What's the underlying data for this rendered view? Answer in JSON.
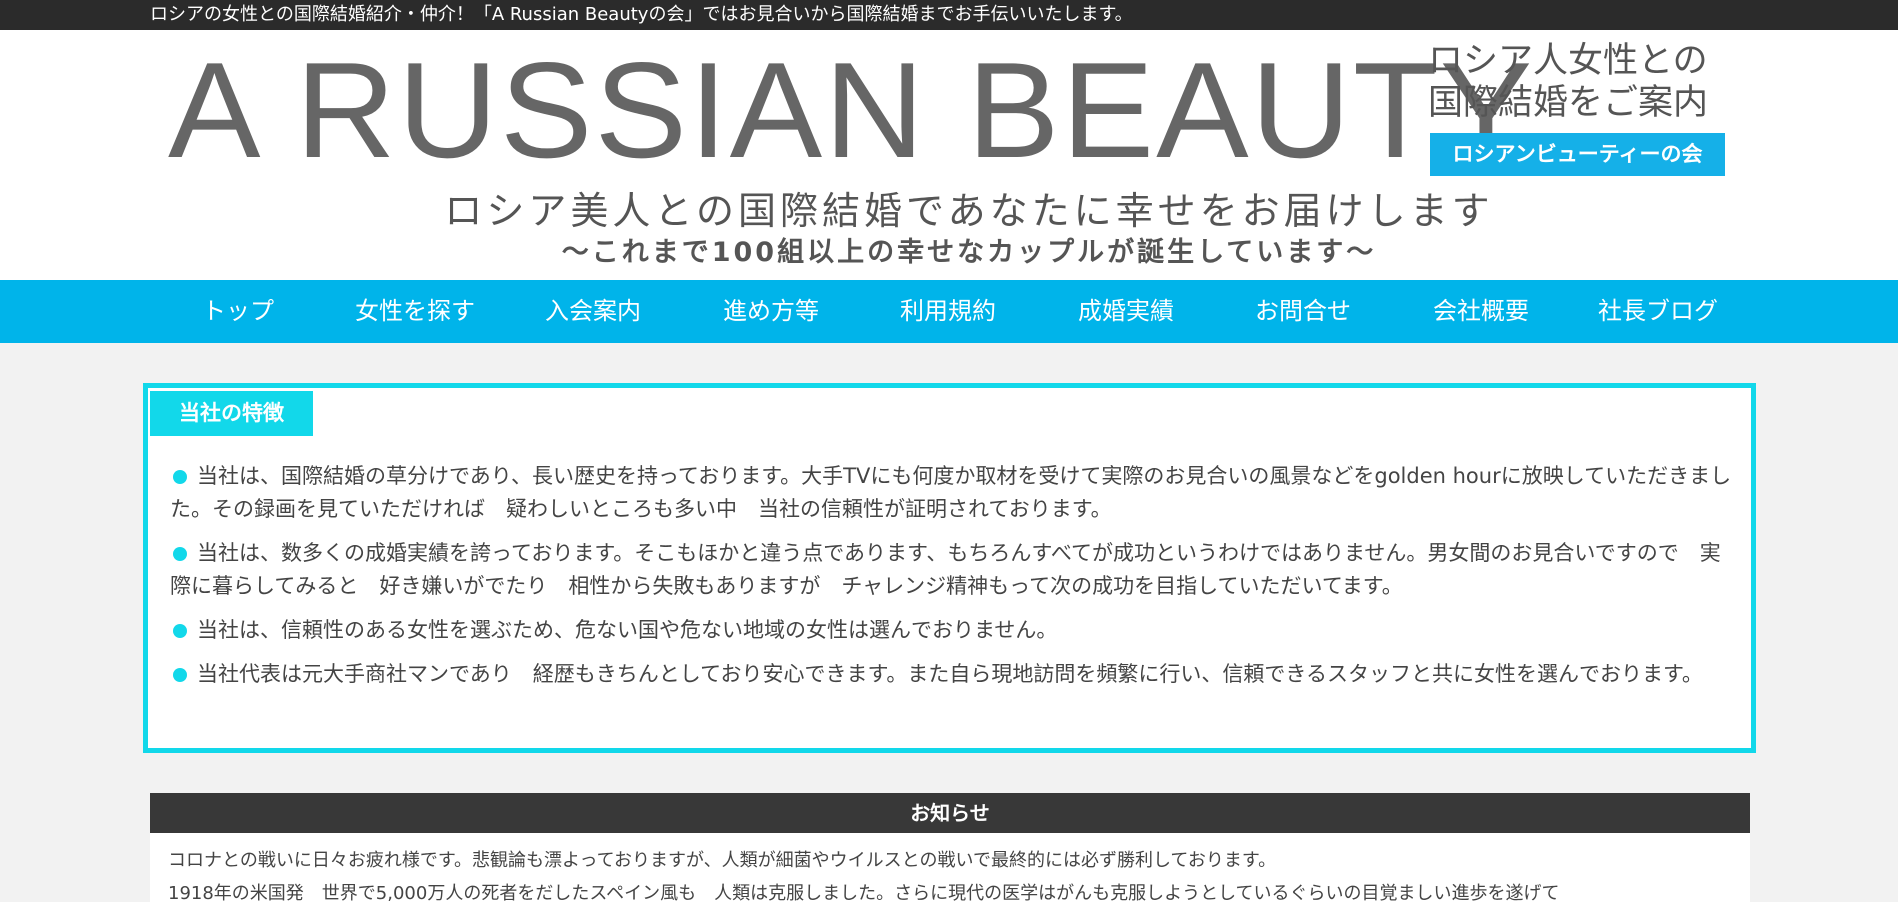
{
  "topbar": {
    "text": "ロシアの女性との国際結婚紹介・仲介！「A Russian Beautyの会」ではお見合いから国際結婚までお手伝いいたします。"
  },
  "header": {
    "logo": "A RUSSIAN BEAUTY",
    "tagline_line1": "ロシア人女性との",
    "tagline_line2": "国際結婚をご案内",
    "badge": "ロシアンビューティーの会",
    "subline1": "ロシア美人との国際結婚であなたに幸せをお届けします",
    "subline2": "～これまで100組以上の幸せなカップルが誕生しています～"
  },
  "nav": {
    "items": [
      {
        "label": "トップ"
      },
      {
        "label": "女性を探す"
      },
      {
        "label": "入会案内"
      },
      {
        "label": "進め方等"
      },
      {
        "label": "利用規約"
      },
      {
        "label": "成婚実績"
      },
      {
        "label": "お問合せ"
      },
      {
        "label": "会社概要"
      },
      {
        "label": "社長ブログ"
      }
    ]
  },
  "features": {
    "title": "当社の特徴",
    "items": [
      "当社は、国際結婚の草分けであり、長い歴史を持っております。大手TVにも何度か取材を受けて実際のお見合いの風景などをgolden hourに放映していただきました。その録画を見ていただければ　疑わしいところも多い中　当社の信頼性が証明されております。",
      "当社は、数多くの成婚実績を誇っております。そこもほかと違う点であります、もちろんすべてが成功というわけではありません。男女間のお見合いですので　実際に暮らしてみると　好き嫌いがでたり　相性から失敗もありますが　チャレンジ精神もって次の成功を目指していただいてます。",
      "当社は、信頼性のある女性を選ぶため、危ない国や危ない地域の女性は選んでおりません。",
      "当社代表は元大手商社マンであり　経歴もきちんとしており安心できます。また自ら現地訪問を頻繁に行い、信頼できるスタッフと共に女性を選んでおります。"
    ]
  },
  "news": {
    "title": "お知らせ",
    "line1": "コロナとの戦いに日々お疲れ様です。悲観論も漂よっておりますが、人類が細菌やウイルスとの戦いで最終的には必ず勝利しております。",
    "line2": "1918年の米国発　世界で5,000万人の死者をだしたスペイン風も　人類は克服しました。さらに現代の医学はがんも克服しようとしているぐらいの目覚ましい進歩を遂げて"
  }
}
